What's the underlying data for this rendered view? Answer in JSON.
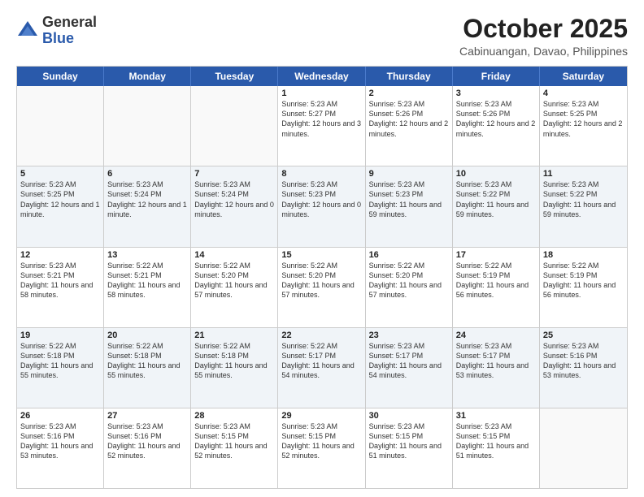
{
  "logo": {
    "general": "General",
    "blue": "Blue"
  },
  "title": "October 2025",
  "location": "Cabinuangan, Davao, Philippines",
  "weekdays": [
    "Sunday",
    "Monday",
    "Tuesday",
    "Wednesday",
    "Thursday",
    "Friday",
    "Saturday"
  ],
  "weeks": [
    [
      {
        "day": "",
        "info": ""
      },
      {
        "day": "",
        "info": ""
      },
      {
        "day": "",
        "info": ""
      },
      {
        "day": "1",
        "info": "Sunrise: 5:23 AM\nSunset: 5:27 PM\nDaylight: 12 hours and 3 minutes."
      },
      {
        "day": "2",
        "info": "Sunrise: 5:23 AM\nSunset: 5:26 PM\nDaylight: 12 hours and 2 minutes."
      },
      {
        "day": "3",
        "info": "Sunrise: 5:23 AM\nSunset: 5:26 PM\nDaylight: 12 hours and 2 minutes."
      },
      {
        "day": "4",
        "info": "Sunrise: 5:23 AM\nSunset: 5:25 PM\nDaylight: 12 hours and 2 minutes."
      }
    ],
    [
      {
        "day": "5",
        "info": "Sunrise: 5:23 AM\nSunset: 5:25 PM\nDaylight: 12 hours and 1 minute."
      },
      {
        "day": "6",
        "info": "Sunrise: 5:23 AM\nSunset: 5:24 PM\nDaylight: 12 hours and 1 minute."
      },
      {
        "day": "7",
        "info": "Sunrise: 5:23 AM\nSunset: 5:24 PM\nDaylight: 12 hours and 0 minutes."
      },
      {
        "day": "8",
        "info": "Sunrise: 5:23 AM\nSunset: 5:23 PM\nDaylight: 12 hours and 0 minutes."
      },
      {
        "day": "9",
        "info": "Sunrise: 5:23 AM\nSunset: 5:23 PM\nDaylight: 11 hours and 59 minutes."
      },
      {
        "day": "10",
        "info": "Sunrise: 5:23 AM\nSunset: 5:22 PM\nDaylight: 11 hours and 59 minutes."
      },
      {
        "day": "11",
        "info": "Sunrise: 5:23 AM\nSunset: 5:22 PM\nDaylight: 11 hours and 59 minutes."
      }
    ],
    [
      {
        "day": "12",
        "info": "Sunrise: 5:23 AM\nSunset: 5:21 PM\nDaylight: 11 hours and 58 minutes."
      },
      {
        "day": "13",
        "info": "Sunrise: 5:22 AM\nSunset: 5:21 PM\nDaylight: 11 hours and 58 minutes."
      },
      {
        "day": "14",
        "info": "Sunrise: 5:22 AM\nSunset: 5:20 PM\nDaylight: 11 hours and 57 minutes."
      },
      {
        "day": "15",
        "info": "Sunrise: 5:22 AM\nSunset: 5:20 PM\nDaylight: 11 hours and 57 minutes."
      },
      {
        "day": "16",
        "info": "Sunrise: 5:22 AM\nSunset: 5:20 PM\nDaylight: 11 hours and 57 minutes."
      },
      {
        "day": "17",
        "info": "Sunrise: 5:22 AM\nSunset: 5:19 PM\nDaylight: 11 hours and 56 minutes."
      },
      {
        "day": "18",
        "info": "Sunrise: 5:22 AM\nSunset: 5:19 PM\nDaylight: 11 hours and 56 minutes."
      }
    ],
    [
      {
        "day": "19",
        "info": "Sunrise: 5:22 AM\nSunset: 5:18 PM\nDaylight: 11 hours and 55 minutes."
      },
      {
        "day": "20",
        "info": "Sunrise: 5:22 AM\nSunset: 5:18 PM\nDaylight: 11 hours and 55 minutes."
      },
      {
        "day": "21",
        "info": "Sunrise: 5:22 AM\nSunset: 5:18 PM\nDaylight: 11 hours and 55 minutes."
      },
      {
        "day": "22",
        "info": "Sunrise: 5:22 AM\nSunset: 5:17 PM\nDaylight: 11 hours and 54 minutes."
      },
      {
        "day": "23",
        "info": "Sunrise: 5:23 AM\nSunset: 5:17 PM\nDaylight: 11 hours and 54 minutes."
      },
      {
        "day": "24",
        "info": "Sunrise: 5:23 AM\nSunset: 5:17 PM\nDaylight: 11 hours and 53 minutes."
      },
      {
        "day": "25",
        "info": "Sunrise: 5:23 AM\nSunset: 5:16 PM\nDaylight: 11 hours and 53 minutes."
      }
    ],
    [
      {
        "day": "26",
        "info": "Sunrise: 5:23 AM\nSunset: 5:16 PM\nDaylight: 11 hours and 53 minutes."
      },
      {
        "day": "27",
        "info": "Sunrise: 5:23 AM\nSunset: 5:16 PM\nDaylight: 11 hours and 52 minutes."
      },
      {
        "day": "28",
        "info": "Sunrise: 5:23 AM\nSunset: 5:15 PM\nDaylight: 11 hours and 52 minutes."
      },
      {
        "day": "29",
        "info": "Sunrise: 5:23 AM\nSunset: 5:15 PM\nDaylight: 11 hours and 52 minutes."
      },
      {
        "day": "30",
        "info": "Sunrise: 5:23 AM\nSunset: 5:15 PM\nDaylight: 11 hours and 51 minutes."
      },
      {
        "day": "31",
        "info": "Sunrise: 5:23 AM\nSunset: 5:15 PM\nDaylight: 11 hours and 51 minutes."
      },
      {
        "day": "",
        "info": ""
      }
    ]
  ]
}
